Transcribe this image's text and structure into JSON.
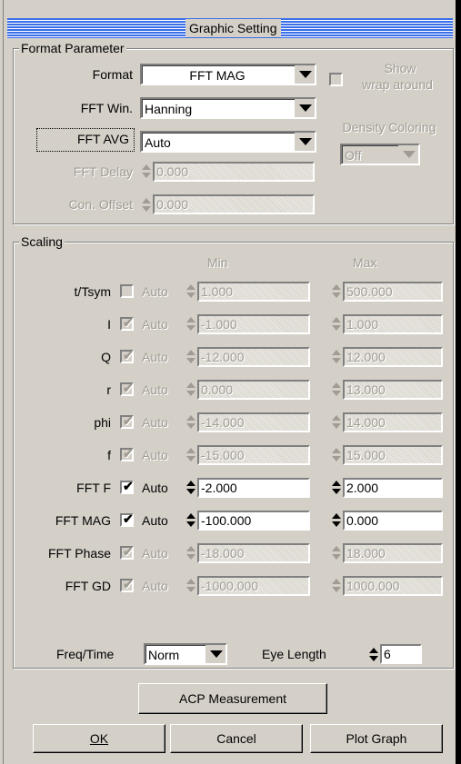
{
  "window": {
    "title": "Graphic Setting"
  },
  "format_parameter": {
    "legend": "Format Parameter",
    "format": {
      "label": "Format",
      "value": "FFT MAG"
    },
    "fft_win": {
      "label": "FFT Win.",
      "value": "Hanning"
    },
    "fft_avg": {
      "label": "FFT AVG",
      "value": "Auto"
    },
    "fft_delay": {
      "label": "FFT Delay",
      "value": "0.000"
    },
    "con_offset": {
      "label": "Con. Offset",
      "value": "0.000"
    },
    "show_wrap": {
      "line1": "Show",
      "line2": "wrap around"
    },
    "density": {
      "label": "Density Coloring",
      "value": "Off"
    }
  },
  "scaling": {
    "legend": "Scaling",
    "min_header": "Min",
    "max_header": "Max",
    "auto_label": "Auto",
    "rows": [
      {
        "label": "t/Tsym",
        "auto": false,
        "enabled": false,
        "min": "1.000",
        "max": "500.000"
      },
      {
        "label": "I",
        "auto": true,
        "enabled": false,
        "min": "-1.000",
        "max": "1.000"
      },
      {
        "label": "Q",
        "auto": true,
        "enabled": false,
        "min": "-12.000",
        "max": "12.000"
      },
      {
        "label": "r",
        "auto": true,
        "enabled": false,
        "min": "0.000",
        "max": "13.000"
      },
      {
        "label": "phi",
        "auto": true,
        "enabled": false,
        "min": "-14.000",
        "max": "14.000"
      },
      {
        "label": "f",
        "auto": true,
        "enabled": false,
        "min": "-15.000",
        "max": "15.000"
      },
      {
        "label": "FFT F",
        "auto": true,
        "enabled": true,
        "min": "-2.000",
        "max": "2.000"
      },
      {
        "label": "FFT MAG",
        "auto": true,
        "enabled": true,
        "min": "-100.000",
        "max": "0.000"
      },
      {
        "label": "FFT Phase",
        "auto": true,
        "enabled": false,
        "min": "-18.000",
        "max": "18.000"
      },
      {
        "label": "FFT GD",
        "auto": true,
        "enabled": false,
        "min": "-1000.000",
        "max": "1000.000"
      }
    ],
    "freq_time": {
      "label": "Freq/Time",
      "value": "Norm"
    },
    "eye_length": {
      "label": "Eye Length",
      "value": "6"
    }
  },
  "buttons": {
    "acp": "ACP Measurement",
    "ok": "OK",
    "cancel": "Cancel",
    "plot": "Plot Graph"
  },
  "icons": {
    "checkmark": "✔"
  }
}
